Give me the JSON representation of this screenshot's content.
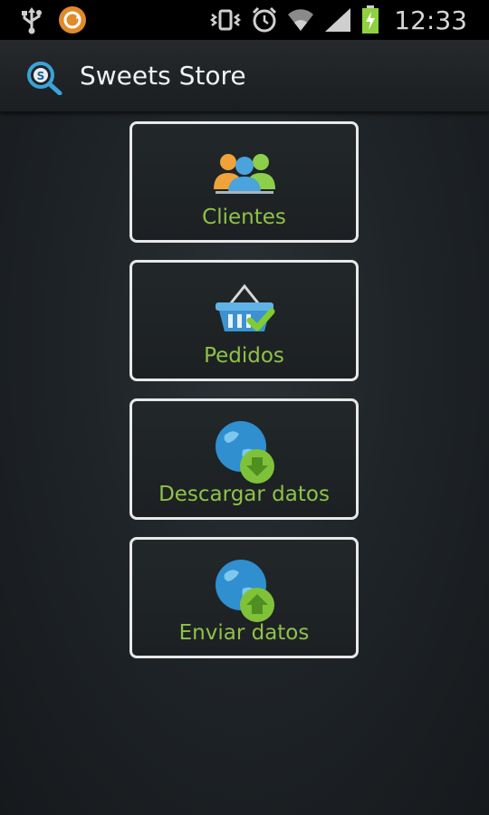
{
  "status_bar": {
    "time": "12:33",
    "icons": [
      "usb-icon",
      "sync-icon",
      "vibrate-icon",
      "alarm-icon",
      "wifi-icon",
      "signal-icon",
      "battery-charging-icon"
    ]
  },
  "action_bar": {
    "title": "Sweets Store",
    "logo_letter": "S"
  },
  "menu": {
    "items": [
      {
        "label": "Clientes",
        "icon": "people-icon"
      },
      {
        "label": "Pedidos",
        "icon": "basket-check-icon"
      },
      {
        "label": "Descargar datos",
        "icon": "globe-download-icon"
      },
      {
        "label": "Enviar datos",
        "icon": "globe-upload-icon"
      }
    ]
  },
  "colors": {
    "label_green": "#8fc248",
    "border": "#e8e8e8",
    "status_bg": "#000000"
  }
}
